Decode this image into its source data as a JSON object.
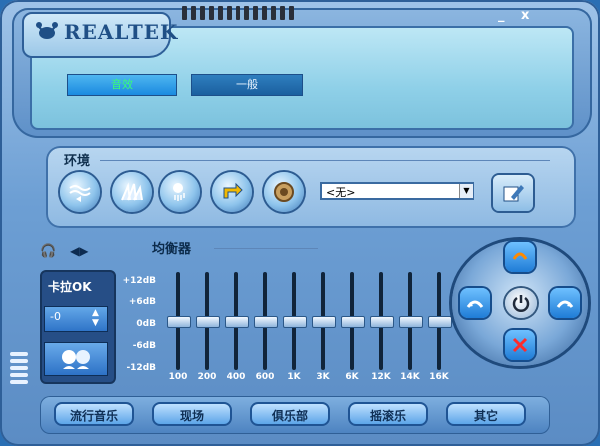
{
  "logo": {
    "text": "REALTEK"
  },
  "window_controls": {
    "minimize": "_",
    "close": "x"
  },
  "tabs": [
    {
      "label": "音效"
    },
    {
      "label": "一般"
    }
  ],
  "environment": {
    "label": "环境",
    "icons": [
      "water-icon",
      "opera-house-icon",
      "shower-icon",
      "pipe-icon",
      "stone-ring-icon"
    ],
    "selected": "<无>",
    "edit_icon": "edit-icon"
  },
  "equalizer": {
    "label": "均衡器",
    "db_labels": [
      "+12dB",
      "+6dB",
      "0dB",
      "-6dB",
      "-12dB"
    ],
    "bands": [
      "100",
      "200",
      "400",
      "600",
      "1K",
      "3K",
      "6K",
      "12K",
      "14K",
      "16K"
    ],
    "levels_db": [
      0,
      0,
      0,
      0,
      0,
      0,
      0,
      0,
      0,
      0
    ]
  },
  "karaoke": {
    "label": "卡拉OK",
    "value": "-0",
    "up": "▲",
    "down": "▼"
  },
  "audio_icons": {
    "headphone": "🎧",
    "speaker": "◀▶"
  },
  "presets": [
    "流行音乐",
    "现场",
    "俱乐部",
    "摇滚乐",
    "其它"
  ],
  "colors": {
    "accent": "#1a8ae0",
    "active_text": "#38ff74"
  }
}
